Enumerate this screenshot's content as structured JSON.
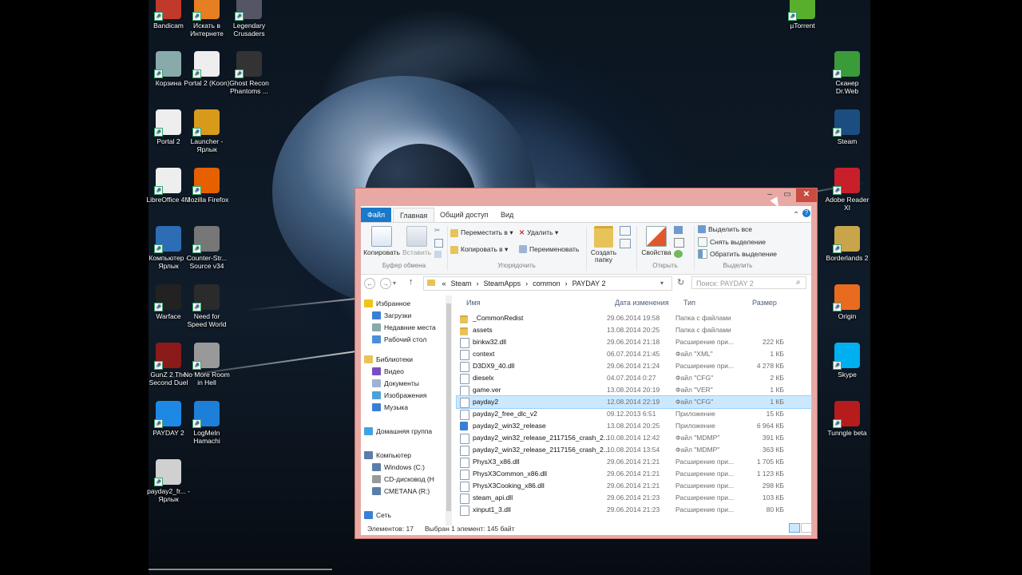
{
  "desktop": {
    "icons": [
      {
        "label": "Bandicam",
        "icon": "bandicam-icon",
        "color": "#c0392b"
      },
      {
        "label": "Искать в Интернете",
        "icon": "search-web-icon",
        "color": "#e67e22"
      },
      {
        "label": "Legendary Crusaders",
        "icon": "game-icon",
        "color": "#556"
      },
      {
        "label": "µTorrent",
        "icon": "utorrent-icon",
        "color": "#5aae2e"
      },
      {
        "label": "Корзина",
        "icon": "recycle-bin-icon",
        "color": "#8aa"
      },
      {
        "label": "Portal 2 (Koon)",
        "icon": "file-icon",
        "color": "#eee"
      },
      {
        "label": "Ghost Recon Phantoms ...",
        "icon": "ghost-recon-icon",
        "color": "#333"
      },
      {
        "label": "Сканер Dr.Web",
        "icon": "drweb-icon",
        "color": "#3a9b3a"
      },
      {
        "label": "Portal 2",
        "icon": "file-icon",
        "color": "#eee"
      },
      {
        "label": "Launcher - Ярлык",
        "icon": "launcher-icon",
        "color": "#d89a1a"
      },
      {
        "label": "Steam",
        "icon": "steam-icon",
        "color": "#1b4d80"
      },
      {
        "label": "LibreOffice 4.1",
        "icon": "libreoffice-icon",
        "color": "#eee"
      },
      {
        "label": "Mozilla Firefox",
        "icon": "firefox-icon",
        "color": "#e66000"
      },
      {
        "label": "Adobe Reader XI",
        "icon": "adobe-reader-icon",
        "color": "#c8202a"
      },
      {
        "label": "Компьютер - Ярлык",
        "icon": "computer-icon",
        "color": "#2d6db5"
      },
      {
        "label": "Counter-Str... Source v34",
        "icon": "counter-strike-icon",
        "color": "#777"
      },
      {
        "label": "Borderlands 2",
        "icon": "folder-icon",
        "color": "#c9a54a"
      },
      {
        "label": "Warface",
        "icon": "warface-icon",
        "color": "#222"
      },
      {
        "label": "Need for Speed World",
        "icon": "nfs-icon",
        "color": "#2b2b2b"
      },
      {
        "label": "Origin",
        "icon": "origin-icon",
        "color": "#e96b1f"
      },
      {
        "label": "GunZ 2 The Second Duel",
        "icon": "gunz-icon",
        "color": "#8b1a1a"
      },
      {
        "label": "No More Room in Hell",
        "icon": "nmrih-icon",
        "color": "#999"
      },
      {
        "label": "Skype",
        "icon": "skype-icon",
        "color": "#00aff0"
      },
      {
        "label": "PAYDAY 2",
        "icon": "payday2-icon",
        "color": "#1e88e5"
      },
      {
        "label": "LogMeIn Hamachi",
        "icon": "hamachi-icon",
        "color": "#1e7fd8"
      },
      {
        "label": "Tunngle beta",
        "icon": "tunngle-icon",
        "color": "#b71c1c"
      },
      {
        "label": "payday2_fr... - Ярлык",
        "icon": "shortcut-file-icon",
        "color": "#d0d0d0"
      }
    ]
  },
  "window": {
    "accent": "#e8a9a4",
    "controls": {
      "minimize": "–",
      "maximize": "▭",
      "close": "✕"
    },
    "tabs": {
      "file": "Файл",
      "home": "Главная",
      "share": "Общий доступ",
      "view": "Вид"
    },
    "ribbon": {
      "copy": "Копировать",
      "paste": "Вставить",
      "move_to": "Переместить в ▾",
      "copy_to": "Копировать в ▾",
      "delete": "Удалить ▾",
      "rename": "Переименовать",
      "new_folder": "Создать папку",
      "properties": "Свойства",
      "select_all": "Выделить все",
      "select_none": "Снять выделение",
      "invert_selection": "Обратить выделение",
      "groups": {
        "clipboard": "Буфер обмена",
        "organize": "Упорядочить",
        "open": "Открыть",
        "select": "Выделить"
      }
    },
    "address": {
      "crumbs": [
        "«",
        "Steam",
        "›",
        "SteamApps",
        "›",
        "common",
        "›",
        "PAYDAY 2"
      ],
      "search_placeholder": "Поиск: PAYDAY 2"
    },
    "nav": {
      "items": [
        "Избранное",
        "Загрузки",
        "Недавние места",
        "Рабочий стол",
        "Библиотеки",
        "Видео",
        "Документы",
        "Изображения",
        "Музыка",
        "Домашняя группа",
        "Компьютер",
        "Windows (C:)",
        "CD-дисковод (H",
        "СМЕТАNA (R:)",
        "Сеть"
      ]
    },
    "columns": {
      "name": "Имя",
      "date": "Дата изменения",
      "type": "Тип",
      "size": "Размер"
    },
    "files": [
      {
        "name": "_CommonRedist",
        "date": "29.06.2014 19:58",
        "type": "Папка с файлами",
        "size": "",
        "kind": "folder"
      },
      {
        "name": "assets",
        "date": "13.08.2014 20:25",
        "type": "Папка с файлами",
        "size": "",
        "kind": "folder"
      },
      {
        "name": "binkw32.dll",
        "date": "29.06.2014 21:18",
        "type": "Расширение при...",
        "size": "222 КБ",
        "kind": "file"
      },
      {
        "name": "context",
        "date": "06.07.2014 21:45",
        "type": "Файл \"XML\"",
        "size": "1 КБ",
        "kind": "file"
      },
      {
        "name": "D3DX9_40.dll",
        "date": "29.06.2014 21:24",
        "type": "Расширение при...",
        "size": "4 278 КБ",
        "kind": "file"
      },
      {
        "name": "dieselx",
        "date": "04.07.2014 0:27",
        "type": "Файл \"CFG\"",
        "size": "2 КБ",
        "kind": "file"
      },
      {
        "name": "game.ver",
        "date": "13.08.2014 20:19",
        "type": "Файл \"VER\"",
        "size": "1 КБ",
        "kind": "file"
      },
      {
        "name": "payday2",
        "date": "12.08.2014 22:19",
        "type": "Файл \"CFG\"",
        "size": "1 КБ",
        "kind": "file",
        "selected": true
      },
      {
        "name": "payday2_free_dlc_v2",
        "date": "09.12.2013 6:51",
        "type": "Приложение",
        "size": "15 КБ",
        "kind": "file"
      },
      {
        "name": "payday2_win32_release",
        "date": "13.08.2014 20:25",
        "type": "Приложение",
        "size": "6 964 КБ",
        "kind": "app"
      },
      {
        "name": "payday2_win32_release_2117156_crash_2...",
        "date": "10.08.2014 12:42",
        "type": "Файл \"MDMP\"",
        "size": "391 КБ",
        "kind": "file"
      },
      {
        "name": "payday2_win32_release_2117156_crash_2...",
        "date": "10.08.2014 13:54",
        "type": "Файл \"MDMP\"",
        "size": "363 КБ",
        "kind": "file"
      },
      {
        "name": "PhysX3_x86.dll",
        "date": "29.06.2014 21:21",
        "type": "Расширение при...",
        "size": "1 705 КБ",
        "kind": "file"
      },
      {
        "name": "PhysX3Common_x86.dll",
        "date": "29.06.2014 21:21",
        "type": "Расширение при...",
        "size": "1 123 КБ",
        "kind": "file"
      },
      {
        "name": "PhysX3Cooking_x86.dll",
        "date": "29.06.2014 21:21",
        "type": "Расширение при...",
        "size": "298 КБ",
        "kind": "file"
      },
      {
        "name": "steam_api.dll",
        "date": "29.06.2014 21:23",
        "type": "Расширение при...",
        "size": "103 КБ",
        "kind": "file"
      },
      {
        "name": "xinput1_3.dll",
        "date": "29.06.2014 21:23",
        "type": "Расширение при...",
        "size": "80 КБ",
        "kind": "file"
      }
    ],
    "status": {
      "count": "Элементов: 17",
      "selected": "Выбран 1 элемент: 145 байт"
    }
  }
}
